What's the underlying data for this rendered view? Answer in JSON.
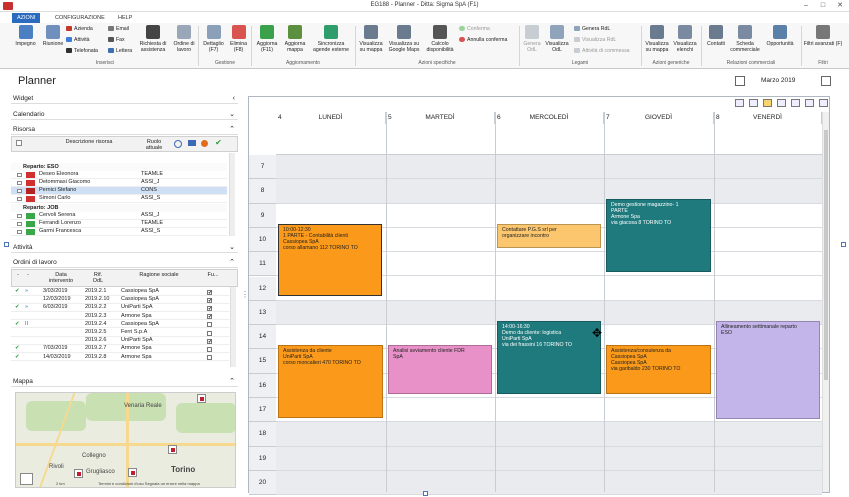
{
  "window": {
    "title": "EG188 - Planner - Ditta: Sigma SpA (F1)",
    "min": "–",
    "max": "□",
    "close": "✕"
  },
  "tabs": [
    "AZIONI",
    "CONFIGURAZIONE",
    "HELP"
  ],
  "ribbon": {
    "impegno": "Impegno",
    "riunione": "Riunione",
    "azienda": "Azienda",
    "attivita": "Attività",
    "telefonata": "Telefonata",
    "email": "Email",
    "fax": "Fax",
    "lettera": "Lettera",
    "richiesta": "Richiesta di assistenza",
    "ordine": "Ordine di lavoro",
    "dettaglio": "Dettaglio (F7)",
    "elimina": "Elimina (F8)",
    "aggiorna": "Aggiorna (F11)",
    "aggiorna_mappa": "Aggiorna mappa",
    "sincronizza": "Sincronizza agende esterne",
    "visualizza_mappa": "Visualizza su mappa",
    "visualizza_google": "Visualizza su Google Maps",
    "calcolo": "Calcolo disponibilità",
    "conferma": "Conferma",
    "annulla_conferma": "Annulla conferma",
    "genera_odl": "Genera OdL",
    "visualizza_odl": "Visualizza OdL",
    "genera_rdl": "Genera RdL",
    "visualizza_rdl": "Visualizza RdL",
    "attivita_commessa": "Attività di commessa",
    "vis_mappa2": "Visualizza su mappa",
    "vis_elenchi": "Visualizza elenchi",
    "contatti": "Contatti",
    "scheda": "Scheda commerciale",
    "opportunita": "Opportunità",
    "filtri": "Filtri avanzati (F)",
    "groups": {
      "inserisci": "Inserisci",
      "gestione": "Gestione",
      "aggiornamento": "Aggiornamento",
      "azioni_specifiche": "Azioni specifiche",
      "legami": "Legami",
      "azioni_generiche": "Azioni generiche",
      "relazioni": "Relazioni commerciali",
      "filtri": "Filtri"
    }
  },
  "page_title": "Planner",
  "month": "Marzo 2019",
  "left": {
    "widget": "Widget",
    "calendario": "Calendario",
    "risorsa": "Risorsa",
    "res_head": {
      "desc": "Descrizione risorsa",
      "ruolo": "Ruolo attuale"
    },
    "groups": [
      {
        "label": "Reparto:  ESO",
        "rows": [
          {
            "name": "Deseo Eleonora",
            "role": "TEAMLE",
            "color": "#d03030"
          },
          {
            "name": "Detommasi Giacomo",
            "role": "ASSI_J",
            "color": "#d03030"
          },
          {
            "name": "Pernici Stefano",
            "role": "CONS",
            "color": "#d03030"
          },
          {
            "name": "Simoni Carlo",
            "role": "ASSI_S",
            "color": "#d03030"
          }
        ]
      },
      {
        "label": "Reparto:  JOB",
        "rows": [
          {
            "name": "Cervoli Serena",
            "role": "ASSI_J",
            "color": "#3aa64a"
          },
          {
            "name": "Ferrandi Lorenzo",
            "role": "TEAMLE",
            "color": "#3aa64a"
          },
          {
            "name": "Garmi Francesca",
            "role": "ASSI_S",
            "color": "#3aa64a"
          }
        ]
      }
    ],
    "attivita": "Attività",
    "ordini": "Ordini di lavoro",
    "odl_head": {
      "data": "Data intervento",
      "rif": "Rif. OdL",
      "ragione": "Ragione sociale",
      "fu": "Fu..."
    },
    "odl_rows": [
      {
        "ok": "✔",
        "st": "»",
        "data": "3/03/2019",
        "rif": "2019.2.1",
        "rag": "Cassiopea SpA",
        "chk": "✔"
      },
      {
        "ok": "",
        "st": "",
        "data": "12/03/2019",
        "rif": "2019.2.10",
        "rag": "Cassiopea SpA",
        "chk": "✔"
      },
      {
        "ok": "✔",
        "st": "»",
        "data": "6/03/2019",
        "rif": "2019.2.2",
        "rag": "UniParti SpA",
        "chk": "✔"
      },
      {
        "ok": "",
        "st": "",
        "data": "",
        "rif": "2019.2.3",
        "rag": "Armone Spa",
        "chk": "✔"
      },
      {
        "ok": "✔",
        "st": "II",
        "data": "",
        "rif": "2019.2.4",
        "rag": "Cassiopea SpA",
        "chk": ""
      },
      {
        "ok": "",
        "st": "",
        "data": "",
        "rif": "2019.2.5",
        "rag": "Ferri S.p.A",
        "chk": ""
      },
      {
        "ok": "",
        "st": "",
        "data": "",
        "rif": "2019.2.6",
        "rag": "UniParti SpA",
        "chk": "✔"
      },
      {
        "ok": "✔",
        "st": "",
        "data": "7/03/2019",
        "rif": "2019.2.7",
        "rag": "Armone Spa",
        "chk": ""
      },
      {
        "ok": "✔",
        "st": "",
        "data": "14/03/2019",
        "rif": "2019.2.8",
        "rag": "Armone Spa",
        "chk": ""
      }
    ],
    "mappa": "Mappa",
    "map": {
      "city1": "Venaria Reale",
      "city2": "Torino",
      "city3": "Collegno",
      "city4": "Grugliasco",
      "city5": "Rivoli",
      "scale": "2 km",
      "footer": "Termini e condizioni d'uso   Segnala un errore nella mappa"
    }
  },
  "calendar": {
    "days": [
      {
        "num": "4",
        "name": "LUNEDÌ"
      },
      {
        "num": "5",
        "name": "MARTEDÌ"
      },
      {
        "num": "6",
        "name": "MERCOLEDÌ"
      },
      {
        "num": "7",
        "name": "GIOVEDÌ"
      },
      {
        "num": "8",
        "name": "VENERDÌ"
      }
    ],
    "hours": [
      "7",
      "8",
      "9",
      "10",
      "11",
      "12",
      "13",
      "14",
      "15",
      "16",
      "17",
      "18",
      "19",
      "20"
    ],
    "events": {
      "e1": {
        "l1": "10:00-12:30",
        "l2": "1 PARTE - Contabilità clienti",
        "l3": "Cassiopea SpA",
        "l4": "corso allamano 112   TORINO  TO"
      },
      "e2": {
        "l1": "Assistenza da cliente",
        "l2": "UniParti SpA",
        "l3": "corso moncalieri 470   TORINO  TO"
      },
      "e3": {
        "l1": "Analisi avviamento cliente FDR",
        "l2": "SpA"
      },
      "e4": {
        "l1": "Contattare P.G.S srl per",
        "l2": "organizzare incontro"
      },
      "e5": {
        "l1": "14:00-16:30",
        "l2": "Demo da cliente: logistica",
        "l3": "UniParti SpA",
        "l4": "via dei frassini 16   TORINO  TO"
      },
      "e6": {
        "l1": "Demo gestione magazzino- 1",
        "l2": "PARTE",
        "l3": "Armone Spa",
        "l4": "via giacosa 8   TORINO  TO"
      },
      "e7": {
        "l1": "Assistenza/consulenza da",
        "l2": "Cassiopea SpA",
        "l3": "Cassiopea SpA",
        "l4": "via garibaldo 230   TORINO  TO"
      },
      "e8": {
        "l1": "Allineamento settimanale reparto",
        "l2": "ESO"
      }
    }
  },
  "colors": {
    "accent": "#2a6bbf",
    "orange": "#fb9a1a",
    "teal": "#1f7a7e",
    "pink": "#e891c9",
    "lavender": "#c3b5e9",
    "light_orange": "#fbc66e"
  }
}
